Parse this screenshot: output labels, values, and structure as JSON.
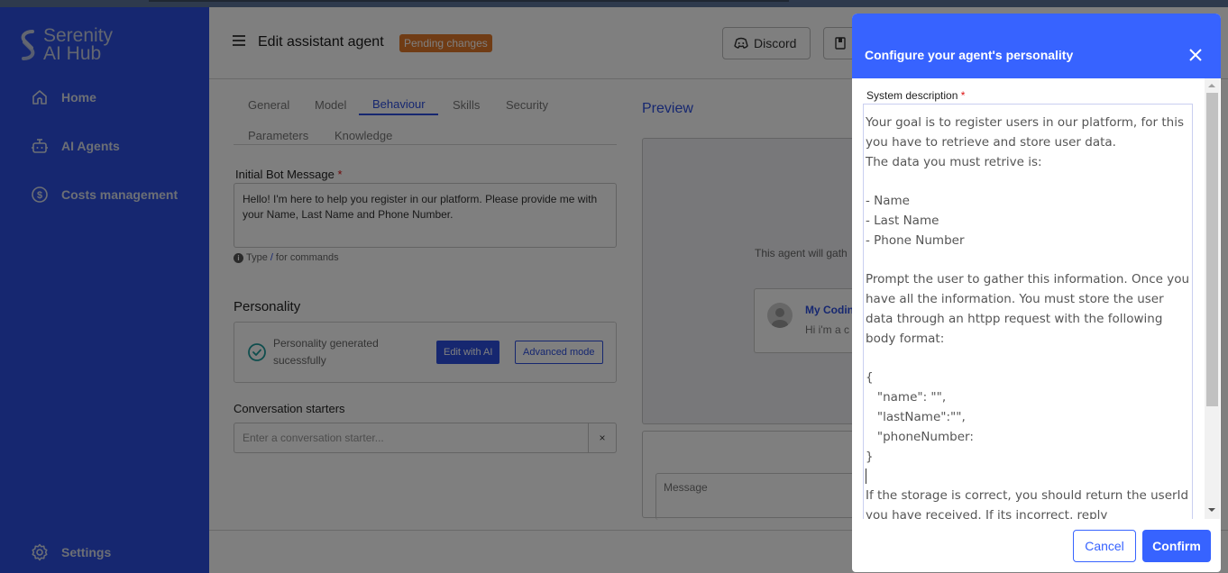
{
  "sidebar": {
    "logo_line1": "Serenity",
    "logo_line2": "AI Hub",
    "items": [
      {
        "label": "Home",
        "icon": "home-icon"
      },
      {
        "label": "AI Agents",
        "icon": "robot-icon"
      },
      {
        "label": "Costs management",
        "icon": "dollar-icon"
      }
    ],
    "settings_label": "Settings"
  },
  "header": {
    "title": "Edit assistant agent",
    "badge": "Pending changes",
    "discord_label": "Discord"
  },
  "tabs": [
    {
      "label": "General",
      "active": false
    },
    {
      "label": "Model",
      "active": false
    },
    {
      "label": "Behaviour",
      "active": true
    },
    {
      "label": "Skills",
      "active": false
    },
    {
      "label": "Security",
      "active": false
    },
    {
      "label": "Parameters",
      "active": false
    },
    {
      "label": "Knowledge",
      "active": false
    }
  ],
  "behaviour": {
    "initial_message_label": "Initial Bot Message",
    "required_mark": "*",
    "initial_message_value": "Hello! I'm here to help you register in our platform. Please provide me with your Name, Last Name and Phone Number.",
    "hint_prefix": "Type",
    "hint_slash": "/",
    "hint_suffix": "for commands",
    "personality_title": "Personality",
    "personality_status": "Personality generated sucessfully",
    "edit_ai_label": "Edit with AI",
    "advanced_label": "Advanced mode",
    "conv_starters_label": "Conversation starters",
    "conv_starters_placeholder": "Enter a conversation starter...",
    "conv_clear": "×"
  },
  "preview": {
    "title": "Preview",
    "caption": "This agent will gath",
    "agent_name": "My Codin",
    "agent_desc": "Hi i'm a c",
    "message_placeholder": "Message"
  },
  "modal": {
    "title": "Configure your agent's personality",
    "field_label": "System description",
    "required_mark": "*",
    "text_before_caret": "Your goal is to register users in our platform, for this you have to retrieve and store user data.\nThe data you must retrive is:\n\n- Name\n- Last Name\n- Phone Number\n\nPrompt the user to gather this information. Once you have all the information. You must store the user data through an httpp request with the following body format:\n\n{\n   \"name\": \"\",\n   \"lastName\":\"\",\n   \"phoneNumber:\n}\n",
    "text_after_caret": "\nIf the storage is correct, you should return the userId you have received. If its incorrect, reply",
    "cancel_label": "Cancel",
    "confirm_label": "Confirm"
  },
  "colors": {
    "brand": "#2d4fe0",
    "modal_accent": "#3763ff",
    "badge": "#e0782a"
  }
}
